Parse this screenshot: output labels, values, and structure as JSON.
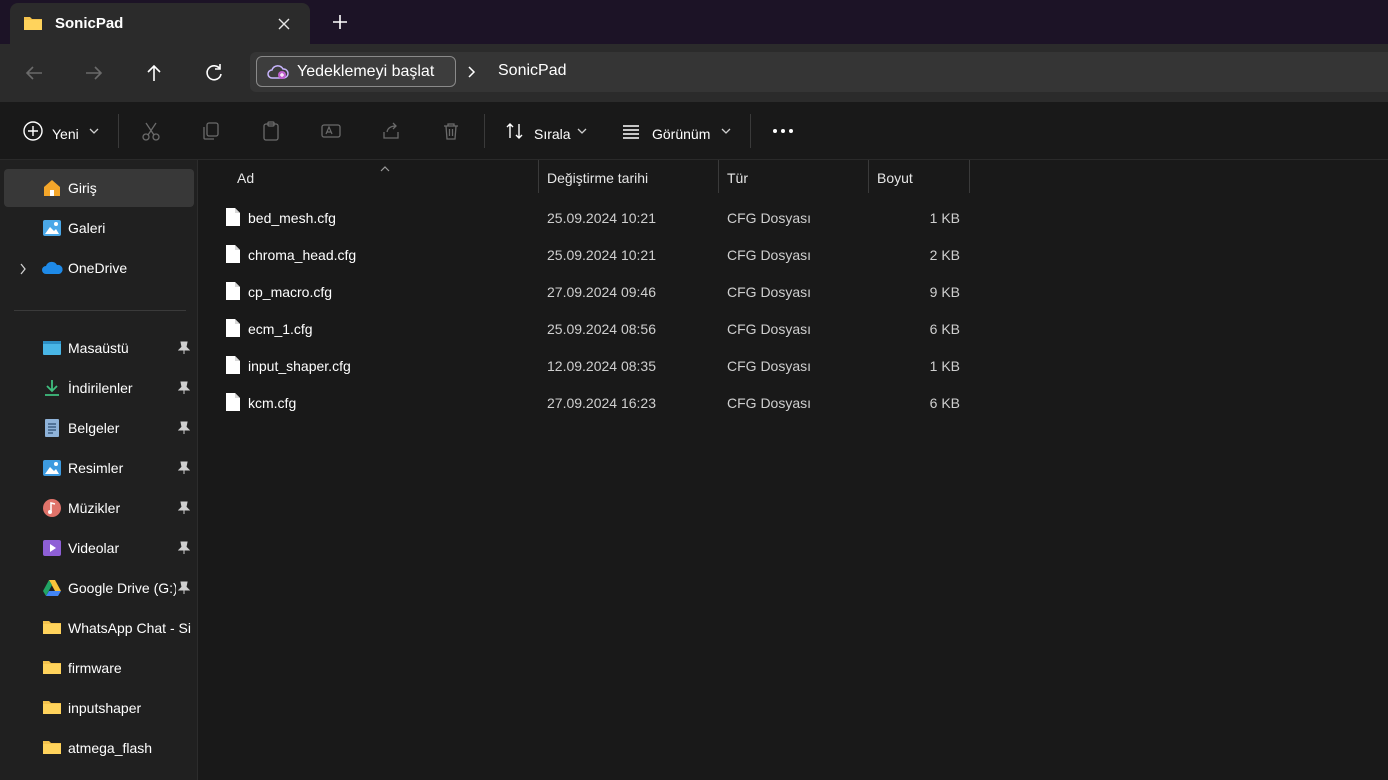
{
  "tab": {
    "title": "SonicPad"
  },
  "address": {
    "backup_label": "Yedeklemeyi başlat",
    "current": "SonicPad"
  },
  "toolbar": {
    "new_label": "Yeni",
    "sort_label": "Sırala",
    "view_label": "Görünüm"
  },
  "sidebar": {
    "items": [
      {
        "label": "Giriş",
        "icon": "home-icon",
        "selected": true
      },
      {
        "label": "Galeri",
        "icon": "gallery-icon"
      },
      {
        "label": "OneDrive",
        "icon": "onedrive-icon"
      },
      {
        "label": "Masaüstü",
        "icon": "desktop-icon",
        "pinned": true
      },
      {
        "label": "İndirilenler",
        "icon": "downloads-icon",
        "pinned": true
      },
      {
        "label": "Belgeler",
        "icon": "documents-icon",
        "pinned": true
      },
      {
        "label": "Resimler",
        "icon": "pictures-icon",
        "pinned": true
      },
      {
        "label": "Müzikler",
        "icon": "music-icon",
        "pinned": true
      },
      {
        "label": "Videolar",
        "icon": "videos-icon",
        "pinned": true
      },
      {
        "label": "Google Drive (G:)",
        "icon": "google-drive-icon",
        "pinned": true
      },
      {
        "label": "WhatsApp Chat - Si",
        "icon": "folder-icon"
      },
      {
        "label": "firmware",
        "icon": "folder-icon"
      },
      {
        "label": "inputshaper",
        "icon": "folder-icon"
      },
      {
        "label": "atmega_flash",
        "icon": "folder-icon"
      }
    ]
  },
  "columns": {
    "name": "Ad",
    "date": "Değiştirme tarihi",
    "type": "Tür",
    "size": "Boyut"
  },
  "files": [
    {
      "name": "bed_mesh.cfg",
      "date": "25.09.2024 10:21",
      "type": "CFG Dosyası",
      "size": "1 KB"
    },
    {
      "name": "chroma_head.cfg",
      "date": "25.09.2024 10:21",
      "type": "CFG Dosyası",
      "size": "2 KB"
    },
    {
      "name": "cp_macro.cfg",
      "date": "27.09.2024 09:46",
      "type": "CFG Dosyası",
      "size": "9 KB"
    },
    {
      "name": "ecm_1.cfg",
      "date": "25.09.2024 08:56",
      "type": "CFG Dosyası",
      "size": "6 KB"
    },
    {
      "name": "input_shaper.cfg",
      "date": "12.09.2024 08:35",
      "type": "CFG Dosyası",
      "size": "1 KB"
    },
    {
      "name": "kcm.cfg",
      "date": "27.09.2024 16:23",
      "type": "CFG Dosyası",
      "size": "6 KB"
    }
  ]
}
